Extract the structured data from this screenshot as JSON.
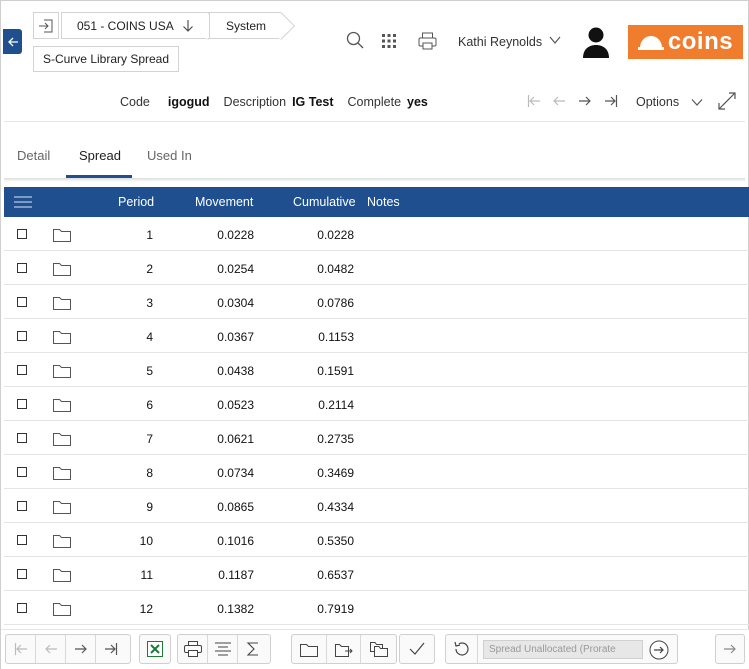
{
  "breadcrumbs": {
    "company": "051 - COINS USA",
    "module": "System",
    "page": "S-Curve Library Spread"
  },
  "header": {
    "user_name": "Kathi Reynolds",
    "logo_text": "coins",
    "brand_color": "#f07d2d",
    "accent_color": "#1f4f8f"
  },
  "record": {
    "code_label": "Code",
    "code_value": "igogud",
    "description_label": "Description",
    "description_value": "IG Test",
    "complete_label": "Complete",
    "complete_value": "yes",
    "options_label": "Options"
  },
  "tabs": [
    {
      "label": "Detail",
      "active": false
    },
    {
      "label": "Spread",
      "active": true
    },
    {
      "label": "Used In",
      "active": false
    }
  ],
  "grid": {
    "columns": {
      "period": "Period",
      "movement": "Movement",
      "cumulative": "Cumulative",
      "notes": "Notes"
    },
    "rows": [
      {
        "period": "1",
        "movement": "0.0228",
        "cumulative": "0.0228",
        "notes": ""
      },
      {
        "period": "2",
        "movement": "0.0254",
        "cumulative": "0.0482",
        "notes": ""
      },
      {
        "period": "3",
        "movement": "0.0304",
        "cumulative": "0.0786",
        "notes": ""
      },
      {
        "period": "4",
        "movement": "0.0367",
        "cumulative": "0.1153",
        "notes": ""
      },
      {
        "period": "5",
        "movement": "0.0438",
        "cumulative": "0.1591",
        "notes": ""
      },
      {
        "period": "6",
        "movement": "0.0523",
        "cumulative": "0.2114",
        "notes": ""
      },
      {
        "period": "7",
        "movement": "0.0621",
        "cumulative": "0.2735",
        "notes": ""
      },
      {
        "period": "8",
        "movement": "0.0734",
        "cumulative": "0.3469",
        "notes": ""
      },
      {
        "period": "9",
        "movement": "0.0865",
        "cumulative": "0.4334",
        "notes": ""
      },
      {
        "period": "10",
        "movement": "0.1016",
        "cumulative": "0.5350",
        "notes": ""
      },
      {
        "period": "11",
        "movement": "0.1187",
        "cumulative": "0.6537",
        "notes": ""
      },
      {
        "period": "12",
        "movement": "0.1382",
        "cumulative": "0.7919",
        "notes": ""
      }
    ]
  },
  "toolbar": {
    "spread_placeholder": "Spread Unallocated (Prorate"
  }
}
